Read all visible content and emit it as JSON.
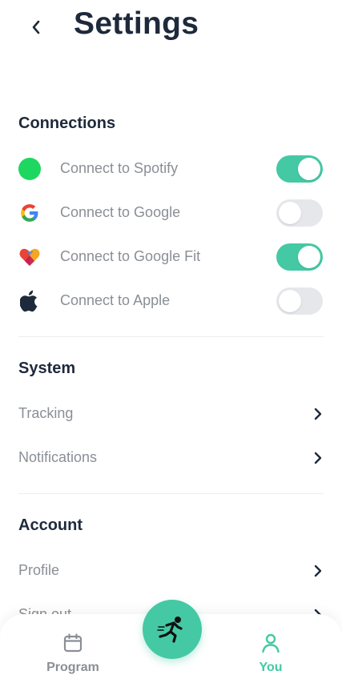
{
  "header": {
    "title": "Settings"
  },
  "connections": {
    "title": "Connections",
    "items": [
      {
        "label": "Connect to Spotify",
        "enabled": true,
        "icon": "spotify-icon",
        "color": "#1ed760"
      },
      {
        "label": "Connect to Google",
        "enabled": false,
        "icon": "google-icon"
      },
      {
        "label": "Connect to Google Fit",
        "enabled": true,
        "icon": "google-fit-icon"
      },
      {
        "label": "Connect to Apple",
        "enabled": false,
        "icon": "apple-icon"
      }
    ]
  },
  "system": {
    "title": "System",
    "items": [
      {
        "label": "Tracking"
      },
      {
        "label": "Notifications"
      }
    ]
  },
  "account": {
    "title": "Account",
    "items": [
      {
        "label": "Profile"
      },
      {
        "label": "Sign out"
      }
    ]
  },
  "tabbar": {
    "program_label": "Program",
    "you_label": "You",
    "active": "You"
  },
  "colors": {
    "accent": "#44c9a4",
    "toggle_off": "#e5e7eb",
    "text_dark": "#1e2a3b",
    "text_muted": "#8a8f96"
  }
}
